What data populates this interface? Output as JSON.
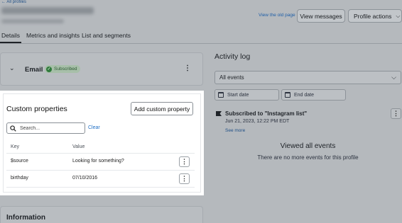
{
  "header": {
    "back_link": "← All profiles",
    "view_old_page": "View the old page",
    "view_messages": "View messages",
    "profile_actions": "Profile actions"
  },
  "tabs": [
    {
      "label": "Details",
      "active": true
    },
    {
      "label": "Metrics and insights",
      "active": false
    },
    {
      "label": "List and segments",
      "active": false
    }
  ],
  "email_card": {
    "title": "Email",
    "status": "Subscribed"
  },
  "custom_properties": {
    "title": "Custom properties",
    "add_button": "Add custom property",
    "search_placeholder": "Search...",
    "clear": "Clear",
    "columns": [
      "Key",
      "Value"
    ],
    "rows": [
      {
        "key": "$source",
        "value": "Looking for something?"
      },
      {
        "key": "birthday",
        "value": "07/10/2016"
      }
    ]
  },
  "information": {
    "title": "Information"
  },
  "activity_log": {
    "title": "Activity log",
    "filter_selected": "All events",
    "start_date_placeholder": "Start date",
    "end_date_placeholder": "End date",
    "events": [
      {
        "title": "Subscribed to \"Instagram list\"",
        "date": "Jun 21, 2023, 12:22 PM EDT",
        "more": "See more"
      }
    ],
    "viewed_all": "Viewed all events",
    "no_more": "There are no more events for this profile"
  },
  "colors": {
    "highlight_panel": "#ffffff",
    "dim_background": "#b5b9bd",
    "link": "#1f6fc5",
    "subscribed_badge": "#2f7a3b"
  }
}
